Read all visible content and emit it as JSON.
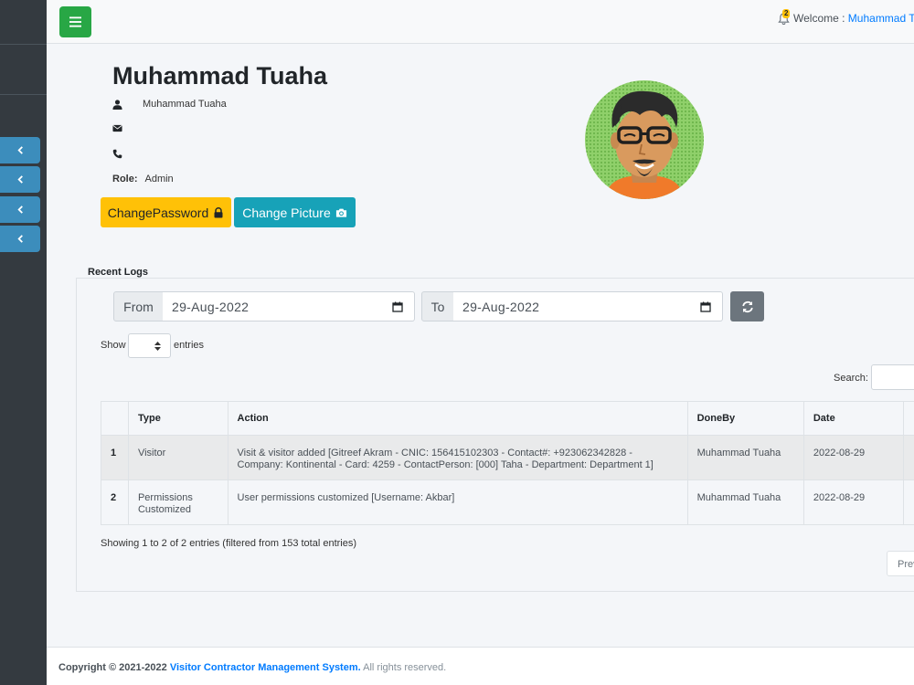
{
  "navbar": {
    "notification_count": "2",
    "welcome_label": "Welcome : ",
    "user_name": "Muhammad Tuaha"
  },
  "profile": {
    "name": "Muhammad Tuaha",
    "username": "Muhammad Tuaha",
    "email": "",
    "phone": "",
    "role_label": "Role:",
    "role": "Admin",
    "change_password_label": "ChangePassword",
    "change_picture_label": "Change Picture"
  },
  "logs": {
    "title": "Recent Logs",
    "from_label": "From",
    "from_value": "29-Aug-2022",
    "to_label": "To",
    "to_value": "29-Aug-2022",
    "show_label": "Show",
    "entries_label": "entries",
    "search_label": "Search:",
    "columns": [
      "",
      "Type",
      "Action",
      "DoneBy",
      "Date"
    ],
    "rows": [
      {
        "num": "1",
        "type": "Visitor",
        "action": "Visit & visitor added [Gitreef Akram - CNIC: 156415102303 - Contact#: +923062342828 - Company: Kontinental - Card: 4259 - ContactPerson: [000] Taha - Department: Department 1]",
        "done_by": "Muhammad Tuaha",
        "date": "2022-08-29"
      },
      {
        "num": "2",
        "type": "Permissions Customized",
        "action": "User permissions customized [Username: Akbar]",
        "done_by": "Muhammad Tuaha",
        "date": "2022-08-29"
      }
    ],
    "showing_text": "Showing 1 to 2 of 2 entries (filtered from 153 total entries)",
    "prev_label": "Prev"
  },
  "footer": {
    "copyright": "Copyright © 2021-2022 ",
    "system_name": "Visitor Contractor Management System.",
    "rights": " All rights reserved."
  },
  "colors": {
    "sidebar": "#343a40",
    "sidebar_button": "#3c8dbc",
    "menu_button": "#28a745",
    "warning": "#ffc107",
    "info": "#17a2b8",
    "secondary": "#6c757d",
    "link": "#007bff"
  },
  "icons": {
    "menu": "bars-icon",
    "notification": "bell-icon",
    "user": "user-icon",
    "email": "envelope-icon",
    "phone": "phone-icon",
    "lock": "lock-icon",
    "camera": "camera-icon",
    "calendar": "calendar-icon",
    "refresh": "refresh-icon",
    "sidebar_toggle": "chevron-left-icon"
  }
}
